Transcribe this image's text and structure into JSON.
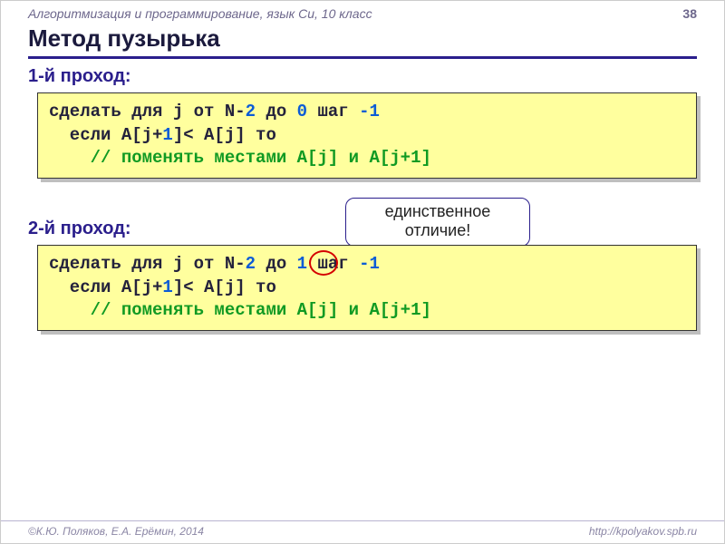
{
  "header": {
    "course": "Алгоритмизация и программирование, язык Си, 10 класс",
    "page": "38"
  },
  "title": "Метод пузырька",
  "pass1": {
    "heading": "1-й проход:",
    "code": {
      "l1a": "сделать для j от N-",
      "l1b": "2",
      "l1c": " до ",
      "l1d": "0",
      "l1e": " шаг ",
      "l1f": "-1",
      "l2a": "  если A[j+",
      "l2b": "1",
      "l2c": "]< A[j] то",
      "l3": "    // поменять местами A[j] и A[j+1]"
    }
  },
  "callout": "единственное отличие!",
  "pass2": {
    "heading": "2-й проход:",
    "code": {
      "l1a": "сделать для j от N-",
      "l1b": "2",
      "l1c": " до ",
      "l1d": "1",
      "l1e": " шаг ",
      "l1f": "-1",
      "l2a": "  если A[j+",
      "l2b": "1",
      "l2c": "]< A[j] то",
      "l3": "    // поменять местами A[j] и A[j+1]"
    }
  },
  "footer": {
    "authors": "©К.Ю. Поляков, Е.А. Ерёмин, 2014",
    "url": "http://kpolyakov.spb.ru"
  }
}
